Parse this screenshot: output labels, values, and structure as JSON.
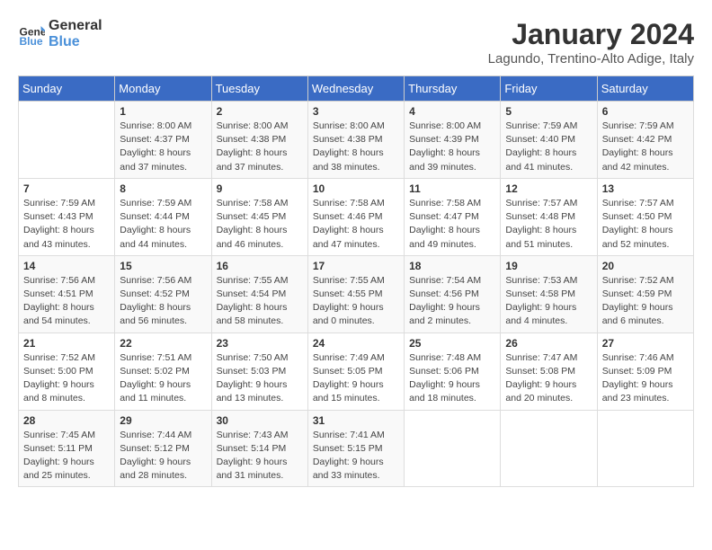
{
  "logo": {
    "line1": "General",
    "line2": "Blue"
  },
  "title": "January 2024",
  "subtitle": "Lagundo, Trentino-Alto Adige, Italy",
  "days_header": [
    "Sunday",
    "Monday",
    "Tuesday",
    "Wednesday",
    "Thursday",
    "Friday",
    "Saturday"
  ],
  "weeks": [
    [
      {
        "day": "",
        "info": ""
      },
      {
        "day": "1",
        "info": "Sunrise: 8:00 AM\nSunset: 4:37 PM\nDaylight: 8 hours\nand 37 minutes."
      },
      {
        "day": "2",
        "info": "Sunrise: 8:00 AM\nSunset: 4:38 PM\nDaylight: 8 hours\nand 37 minutes."
      },
      {
        "day": "3",
        "info": "Sunrise: 8:00 AM\nSunset: 4:38 PM\nDaylight: 8 hours\nand 38 minutes."
      },
      {
        "day": "4",
        "info": "Sunrise: 8:00 AM\nSunset: 4:39 PM\nDaylight: 8 hours\nand 39 minutes."
      },
      {
        "day": "5",
        "info": "Sunrise: 7:59 AM\nSunset: 4:40 PM\nDaylight: 8 hours\nand 41 minutes."
      },
      {
        "day": "6",
        "info": "Sunrise: 7:59 AM\nSunset: 4:42 PM\nDaylight: 8 hours\nand 42 minutes."
      }
    ],
    [
      {
        "day": "7",
        "info": "Sunrise: 7:59 AM\nSunset: 4:43 PM\nDaylight: 8 hours\nand 43 minutes."
      },
      {
        "day": "8",
        "info": "Sunrise: 7:59 AM\nSunset: 4:44 PM\nDaylight: 8 hours\nand 44 minutes."
      },
      {
        "day": "9",
        "info": "Sunrise: 7:58 AM\nSunset: 4:45 PM\nDaylight: 8 hours\nand 46 minutes."
      },
      {
        "day": "10",
        "info": "Sunrise: 7:58 AM\nSunset: 4:46 PM\nDaylight: 8 hours\nand 47 minutes."
      },
      {
        "day": "11",
        "info": "Sunrise: 7:58 AM\nSunset: 4:47 PM\nDaylight: 8 hours\nand 49 minutes."
      },
      {
        "day": "12",
        "info": "Sunrise: 7:57 AM\nSunset: 4:48 PM\nDaylight: 8 hours\nand 51 minutes."
      },
      {
        "day": "13",
        "info": "Sunrise: 7:57 AM\nSunset: 4:50 PM\nDaylight: 8 hours\nand 52 minutes."
      }
    ],
    [
      {
        "day": "14",
        "info": "Sunrise: 7:56 AM\nSunset: 4:51 PM\nDaylight: 8 hours\nand 54 minutes."
      },
      {
        "day": "15",
        "info": "Sunrise: 7:56 AM\nSunset: 4:52 PM\nDaylight: 8 hours\nand 56 minutes."
      },
      {
        "day": "16",
        "info": "Sunrise: 7:55 AM\nSunset: 4:54 PM\nDaylight: 8 hours\nand 58 minutes."
      },
      {
        "day": "17",
        "info": "Sunrise: 7:55 AM\nSunset: 4:55 PM\nDaylight: 9 hours\nand 0 minutes."
      },
      {
        "day": "18",
        "info": "Sunrise: 7:54 AM\nSunset: 4:56 PM\nDaylight: 9 hours\nand 2 minutes."
      },
      {
        "day": "19",
        "info": "Sunrise: 7:53 AM\nSunset: 4:58 PM\nDaylight: 9 hours\nand 4 minutes."
      },
      {
        "day": "20",
        "info": "Sunrise: 7:52 AM\nSunset: 4:59 PM\nDaylight: 9 hours\nand 6 minutes."
      }
    ],
    [
      {
        "day": "21",
        "info": "Sunrise: 7:52 AM\nSunset: 5:00 PM\nDaylight: 9 hours\nand 8 minutes."
      },
      {
        "day": "22",
        "info": "Sunrise: 7:51 AM\nSunset: 5:02 PM\nDaylight: 9 hours\nand 11 minutes."
      },
      {
        "day": "23",
        "info": "Sunrise: 7:50 AM\nSunset: 5:03 PM\nDaylight: 9 hours\nand 13 minutes."
      },
      {
        "day": "24",
        "info": "Sunrise: 7:49 AM\nSunset: 5:05 PM\nDaylight: 9 hours\nand 15 minutes."
      },
      {
        "day": "25",
        "info": "Sunrise: 7:48 AM\nSunset: 5:06 PM\nDaylight: 9 hours\nand 18 minutes."
      },
      {
        "day": "26",
        "info": "Sunrise: 7:47 AM\nSunset: 5:08 PM\nDaylight: 9 hours\nand 20 minutes."
      },
      {
        "day": "27",
        "info": "Sunrise: 7:46 AM\nSunset: 5:09 PM\nDaylight: 9 hours\nand 23 minutes."
      }
    ],
    [
      {
        "day": "28",
        "info": "Sunrise: 7:45 AM\nSunset: 5:11 PM\nDaylight: 9 hours\nand 25 minutes."
      },
      {
        "day": "29",
        "info": "Sunrise: 7:44 AM\nSunset: 5:12 PM\nDaylight: 9 hours\nand 28 minutes."
      },
      {
        "day": "30",
        "info": "Sunrise: 7:43 AM\nSunset: 5:14 PM\nDaylight: 9 hours\nand 31 minutes."
      },
      {
        "day": "31",
        "info": "Sunrise: 7:41 AM\nSunset: 5:15 PM\nDaylight: 9 hours\nand 33 minutes."
      },
      {
        "day": "",
        "info": ""
      },
      {
        "day": "",
        "info": ""
      },
      {
        "day": "",
        "info": ""
      }
    ]
  ]
}
